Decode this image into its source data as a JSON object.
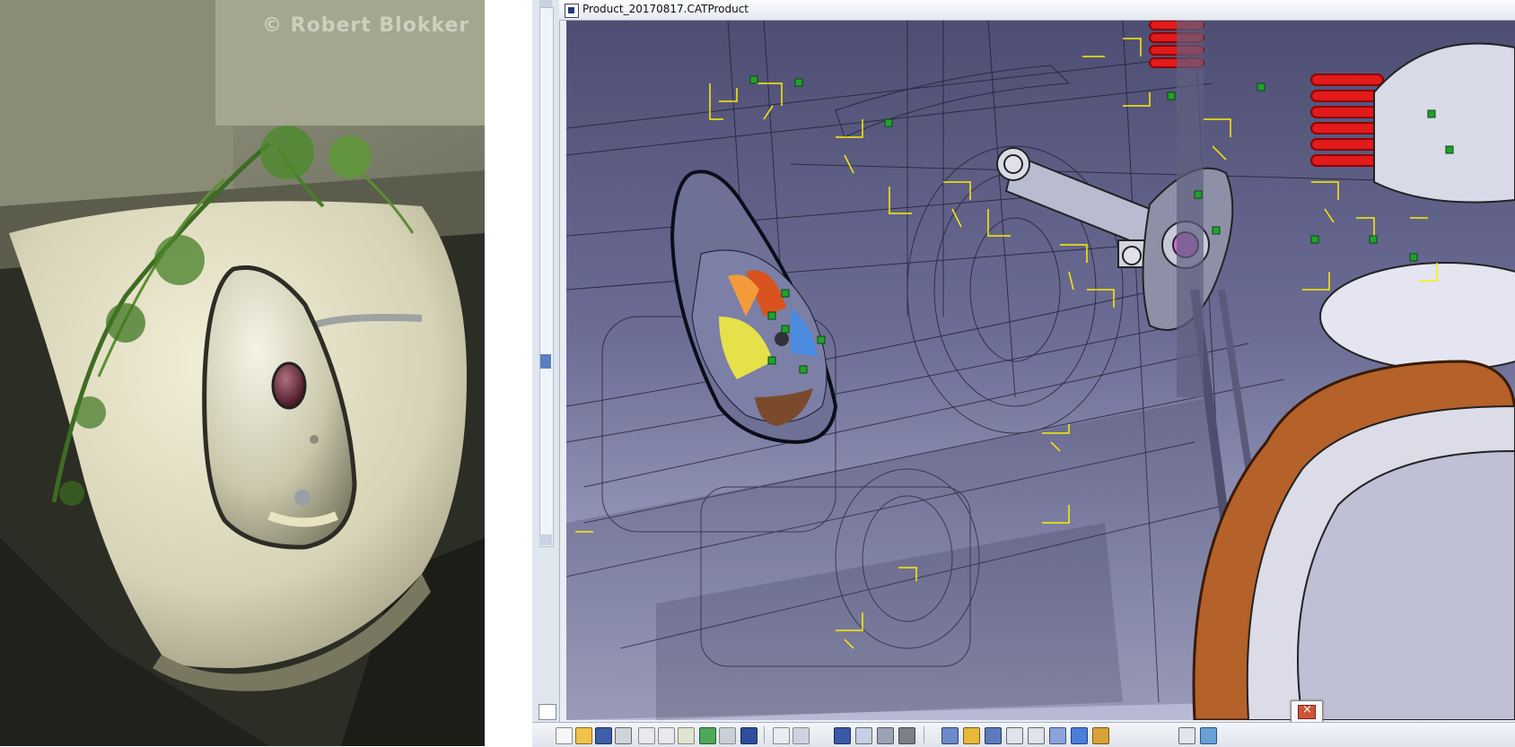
{
  "photo": {
    "watermark": "© Robert Blokker"
  },
  "catia_window": {
    "title": "Product_20170817.CATProduct"
  },
  "toolbar": {
    "icons": [
      "new-icon",
      "open-icon",
      "save-icon",
      "print-icon",
      "cut-icon",
      "copy-icon",
      "paste-icon",
      "undo-icon",
      "redo-icon",
      "help-icon",
      "formula-icon",
      "rotate-icon",
      "grid-icon",
      "tree-icon",
      "measure-icon",
      "lock-icon",
      "pan-icon",
      "fit-all-icon",
      "rotate-view-icon",
      "zoom-in-icon",
      "zoom-out-icon",
      "normal-view-icon",
      "iso-view-icon",
      "render-style-icon",
      "hide-show-icon",
      "swap-visible-icon"
    ]
  },
  "colors": {
    "viewport_top": "#4e4e74",
    "viewport_bottom": "#b9bbd6",
    "constraint_yellow": "#ffee00",
    "anchor_green": "#1fa32a"
  }
}
